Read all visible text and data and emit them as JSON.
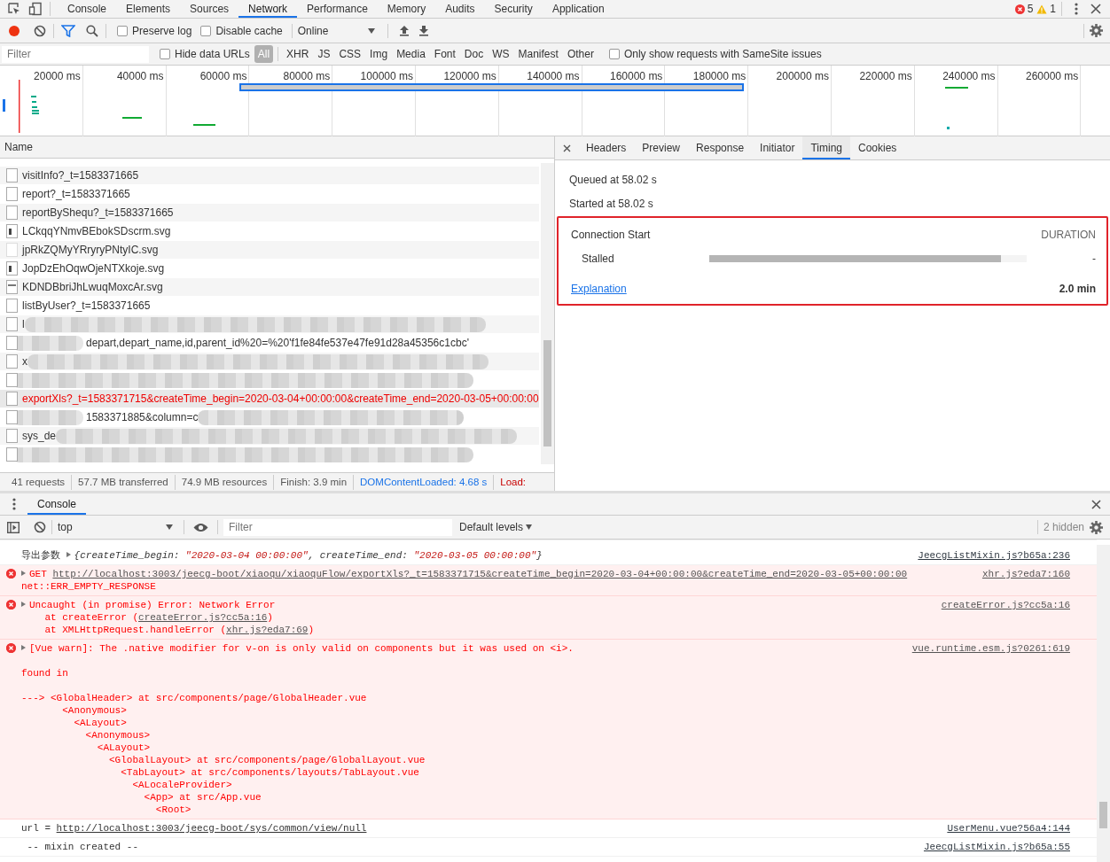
{
  "main_tabs": [
    {
      "label": "Console",
      "selected": false
    },
    {
      "label": "Elements",
      "selected": false
    },
    {
      "label": "Sources",
      "selected": false
    },
    {
      "label": "Network",
      "selected": true
    },
    {
      "label": "Performance",
      "selected": false
    },
    {
      "label": "Memory",
      "selected": false
    },
    {
      "label": "Audits",
      "selected": false
    },
    {
      "label": "Security",
      "selected": false
    },
    {
      "label": "Application",
      "selected": false
    }
  ],
  "issue_counts": {
    "errors": "5",
    "warnings": "1"
  },
  "network_toolbar": {
    "recording": true,
    "preserve_log": {
      "label": "Preserve log",
      "checked": false
    },
    "disable_cache": {
      "label": "Disable cache",
      "checked": false
    },
    "throttling": "Online"
  },
  "filter_bar": {
    "placeholder": "Filter",
    "hide_data_urls": {
      "label": "Hide data URLs",
      "checked": false
    },
    "types": [
      {
        "label": "All",
        "selected": true
      },
      {
        "label": "XHR",
        "selected": false
      },
      {
        "label": "JS",
        "selected": false
      },
      {
        "label": "CSS",
        "selected": false
      },
      {
        "label": "Img",
        "selected": false
      },
      {
        "label": "Media",
        "selected": false
      },
      {
        "label": "Font",
        "selected": false
      },
      {
        "label": "Doc",
        "selected": false
      },
      {
        "label": "WS",
        "selected": false
      },
      {
        "label": "Manifest",
        "selected": false
      },
      {
        "label": "Other",
        "selected": false
      }
    ],
    "samesite": {
      "label": "Only show requests with SameSite issues",
      "checked": false
    }
  },
  "timeline": {
    "ticks": [
      "20000 ms",
      "40000 ms",
      "60000 ms",
      "80000 ms",
      "100000 ms",
      "120000 ms",
      "140000 ms",
      "160000 ms",
      "180000 ms",
      "200000 ms",
      "220000 ms",
      "240000 ms",
      "260000 ms"
    ]
  },
  "requests": {
    "column": "Name",
    "rows": [
      {
        "name": "visitInfo?_t=1583371665",
        "kind": "doc",
        "failed": false,
        "selected": false
      },
      {
        "name": "report?_t=1583371665",
        "kind": "doc",
        "failed": false,
        "selected": false
      },
      {
        "name": "reportByShequ?_t=1583371665",
        "kind": "doc",
        "failed": false,
        "selected": false
      },
      {
        "name": "LCkqqYNmvBEbokSDscrm.svg",
        "kind": "image",
        "failed": false,
        "selected": false
      },
      {
        "name": "jpRkZQMyYRryryPNtyIC.svg",
        "kind": "blank",
        "failed": false,
        "selected": false
      },
      {
        "name": "JopDzEhOqwOjeNTXkoje.svg",
        "kind": "image",
        "failed": false,
        "selected": false
      },
      {
        "name": "KDNDBbriJhLwuqMoxcAr.svg",
        "kind": "bar",
        "failed": false,
        "selected": false
      },
      {
        "name": "listByUser?_t=1583371665",
        "kind": "doc",
        "failed": false,
        "selected": false
      },
      {
        "name": "l",
        "kind": "doc",
        "failed": false,
        "selected": false,
        "redacted_after": true
      },
      {
        "name": "depart,depart_name,id,parent_id%20=%20'f1fe84fe537e47fe91d28a45356c1cbc'",
        "kind": "doc",
        "failed": false,
        "selected": false,
        "redacted_before": true
      },
      {
        "name": "x",
        "kind": "doc",
        "failed": false,
        "selected": false,
        "redacted_after": true
      },
      {
        "kind": "doc",
        "selected": false,
        "redacted_before": true
      },
      {
        "name": "exportXls?_t=1583371715&createTime_begin=2020-03-04+00:00:00&createTime_end=2020-03-05+00:00:00",
        "kind": "doc",
        "failed": true,
        "selected": true
      },
      {
        "name": "1583371885&column=c",
        "kind": "doc",
        "failed": false,
        "selected": false,
        "redacted_before": true,
        "redacted_after": true
      },
      {
        "name": "sys_de",
        "kind": "doc",
        "failed": false,
        "selected": false,
        "redacted_after": true
      },
      {
        "kind": "doc",
        "selected": false,
        "redacted_before": true
      }
    ]
  },
  "summary": [
    {
      "text": "41 requests",
      "kind": "plain"
    },
    {
      "text": "57.7 MB transferred",
      "kind": "plain"
    },
    {
      "text": "74.9 MB resources",
      "kind": "plain"
    },
    {
      "text": "Finish: 3.9 min",
      "kind": "plain"
    },
    {
      "text": "DOMContentLoaded: 4.68 s",
      "kind": "dcl"
    },
    {
      "text": "Load:",
      "kind": "load"
    }
  ],
  "details": {
    "tabs": [
      {
        "label": "Headers",
        "selected": false
      },
      {
        "label": "Preview",
        "selected": false
      },
      {
        "label": "Response",
        "selected": false
      },
      {
        "label": "Initiator",
        "selected": false
      },
      {
        "label": "Timing",
        "selected": true
      },
      {
        "label": "Cookies",
        "selected": false
      }
    ],
    "queued": "Queued at 58.02 s",
    "started": "Started at 58.02 s",
    "section": "Connection Start",
    "duration_header": "DURATION",
    "phases": [
      {
        "name": "Stalled",
        "level": 0.92,
        "duration": "-"
      }
    ],
    "explanation": "Explanation",
    "total": "2.0 min"
  },
  "console": {
    "tab": "Console",
    "context": "top",
    "filter_placeholder": "Filter",
    "levels": "Default levels",
    "hidden": "2 hidden",
    "messages": [
      {
        "kind": "log",
        "expandable": true,
        "source": "JeecgListMixin.js?b65a:236",
        "lines": [
          {
            "parts": [
              {
                "text": "导出参数 ",
                "kind": "plain"
              },
              {
                "text": "{createTime_begin: ",
                "kind": "key"
              },
              {
                "text": "\"2020-03-04 00:00:00\"",
                "kind": "string"
              },
              {
                "text": ", createTime_end: ",
                "kind": "key"
              },
              {
                "text": "\"2020-03-05 00:00:00\"",
                "kind": "string"
              },
              {
                "text": "}",
                "kind": "key"
              }
            ]
          }
        ]
      },
      {
        "kind": "error",
        "expandable": true,
        "source": "xhr.js?eda7:160",
        "lines": [
          {
            "parts": [
              {
                "text": "GET ",
                "kind": "plain"
              },
              {
                "text": "http://localhost:3003/jeecg-boot/xiaoqu/xiaoquFlow/exportXls?_t=1583371715&createTime_begin=2020-03-04+00:00:00&createTime_end=2020-03-05+00:00:00",
                "kind": "link"
              }
            ]
          },
          {
            "parts": [
              {
                "text": "net::ERR_EMPTY_RESPONSE",
                "kind": "plain"
              }
            ]
          }
        ]
      },
      {
        "kind": "error",
        "expandable": true,
        "source": "createError.js?cc5a:16",
        "lines": [
          {
            "parts": [
              {
                "text": "Uncaught (in promise) Error: Network Error",
                "kind": "plain"
              }
            ]
          },
          {
            "parts": [
              {
                "text": "    at createError (",
                "kind": "plain"
              },
              {
                "text": "createError.js?cc5a:16",
                "kind": "link"
              },
              {
                "text": ")",
                "kind": "plain"
              }
            ]
          },
          {
            "parts": [
              {
                "text": "    at XMLHttpRequest.handleError (",
                "kind": "plain"
              },
              {
                "text": "xhr.js?eda7:69",
                "kind": "link"
              },
              {
                "text": ")",
                "kind": "plain"
              }
            ]
          }
        ]
      },
      {
        "kind": "error",
        "expandable": true,
        "source": "vue.runtime.esm.js?0261:619",
        "lines": [
          {
            "parts": [
              {
                "text": "[Vue warn]: The .native modifier for v-on is only valid on components but it was used on <i>.",
                "kind": "plain"
              }
            ]
          },
          {
            "space_before": true,
            "parts": [
              {
                "text": "found in",
                "kind": "plain"
              }
            ]
          },
          {
            "space_before": true,
            "parts": [
              {
                "text": "---> <GlobalHeader> at src/components/page/GlobalHeader.vue",
                "kind": "plain"
              }
            ]
          },
          {
            "parts": [
              {
                "text": "       <Anonymous>",
                "kind": "plain"
              }
            ]
          },
          {
            "parts": [
              {
                "text": "         <ALayout>",
                "kind": "plain"
              }
            ]
          },
          {
            "parts": [
              {
                "text": "           <Anonymous>",
                "kind": "plain"
              }
            ]
          },
          {
            "parts": [
              {
                "text": "             <ALayout>",
                "kind": "plain"
              }
            ]
          },
          {
            "parts": [
              {
                "text": "               <GlobalLayout> at src/components/page/GlobalLayout.vue",
                "kind": "plain"
              }
            ]
          },
          {
            "parts": [
              {
                "text": "                 <TabLayout> at src/components/layouts/TabLayout.vue",
                "kind": "plain"
              }
            ]
          },
          {
            "parts": [
              {
                "text": "                   <ALocaleProvider>",
                "kind": "plain"
              }
            ]
          },
          {
            "parts": [
              {
                "text": "                     <App> at src/App.vue",
                "kind": "plain"
              }
            ]
          },
          {
            "parts": [
              {
                "text": "                       <Root>",
                "kind": "plain"
              }
            ]
          }
        ]
      },
      {
        "kind": "log",
        "expandable": false,
        "source": "UserMenu.vue?56a4:144",
        "lines": [
          {
            "parts": [
              {
                "text": "url = ",
                "kind": "plain"
              },
              {
                "text": "http://localhost:3003/jeecg-boot/sys/common/view/null",
                "kind": "link"
              }
            ]
          }
        ]
      },
      {
        "kind": "log",
        "expandable": false,
        "source": "JeecgListMixin.js?b65a:55",
        "lines": [
          {
            "parts": [
              {
                "text": " -- mixin created --",
                "kind": "plain"
              }
            ]
          }
        ]
      }
    ]
  }
}
